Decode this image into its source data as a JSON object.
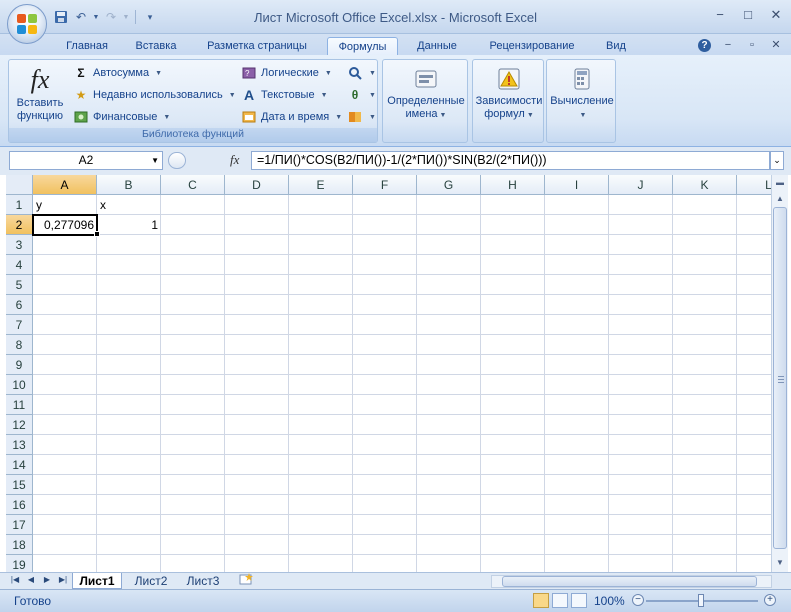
{
  "window": {
    "title": "Лист Microsoft Office Excel.xlsx - Microsoft Excel"
  },
  "tabs": [
    {
      "label": "Главная"
    },
    {
      "label": "Вставка"
    },
    {
      "label": "Разметка страницы"
    },
    {
      "label": "Формулы",
      "active": true
    },
    {
      "label": "Данные"
    },
    {
      "label": "Рецензирование"
    },
    {
      "label": "Вид"
    }
  ],
  "ribbon": {
    "library": {
      "group_label": "Библиотека функций",
      "insert_function": {
        "line1": "Вставить",
        "line2": "функцию"
      },
      "autosum": "Автосумма",
      "recent": "Недавно использовались",
      "financial": "Финансовые",
      "logical": "Логические",
      "text": "Текстовые",
      "datetime": "Дата и время"
    },
    "defined_names": {
      "line1": "Определенные",
      "line2": "имена"
    },
    "dependencies": {
      "line1": "Зависимости",
      "line2": "формул"
    },
    "calculation": {
      "line1": "Вычисление"
    }
  },
  "formula_bar": {
    "name_box": "A2",
    "fx": "fx",
    "formula": "=1/ПИ()*COS(B2/ПИ())-1/(2*ПИ())*SIN(B2/(2*ПИ()))"
  },
  "grid": {
    "columns": [
      "A",
      "B",
      "C",
      "D",
      "E",
      "F",
      "G",
      "H",
      "I",
      "J",
      "K",
      "L"
    ],
    "rows": [
      "1",
      "2",
      "3",
      "4",
      "5",
      "6",
      "7",
      "8",
      "9",
      "10",
      "11",
      "12",
      "13",
      "14",
      "15",
      "16",
      "17",
      "18",
      "19"
    ],
    "cells": {
      "A1": "y",
      "B1": "x",
      "A2": "0,277096",
      "B2": "1"
    },
    "active_cell": "A2"
  },
  "sheets": [
    {
      "label": "Лист1",
      "active": true
    },
    {
      "label": "Лист2"
    },
    {
      "label": "Лист3"
    }
  ],
  "status": {
    "ready": "Готово",
    "zoom": "100%"
  },
  "colors": {
    "accent": "#15428b",
    "selection_header": "#f1c15f"
  }
}
